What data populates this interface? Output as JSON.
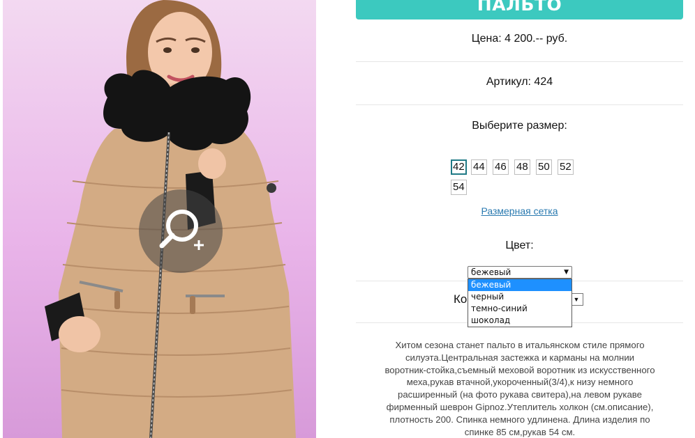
{
  "product": {
    "title": "ПАЛЬТО",
    "price_label": "Цена: ",
    "price_value": "4 200.-- руб.",
    "article_label": "Артикул: ",
    "article_value": "424",
    "size_label": "Выберите размер:",
    "sizes": [
      "42",
      "44",
      "46",
      "48",
      "50",
      "52",
      "54"
    ],
    "selected_size": "42",
    "size_chart_link": "Размерная сетка",
    "color_label": "Цвет:",
    "color_selected": "бежевый",
    "color_options": [
      "бежевый",
      "черный",
      "темно-синий",
      "шоколад"
    ],
    "quantity_label_visible": "Ко",
    "description": "Хитом сезона станет пальто в итальянском стиле прямого силуэта.Центральная застежка и карманы на молнии воротник-стойка,съемный меховой воротник из искусственного меха,рукав втачной,укороченный(3/4),к низу немного расширенный (на фото рукава свитера),на левом рукаве фирменный шеврон Gipnoz.Утеплитель холкон (см.описание), плотность 200. Спинка немного удлинена. Длина изделия по спинке 85 см,рукав 54 см."
  },
  "icons": {
    "zoom": "zoom-in-icon",
    "dropdown_arrow": "triangle-down-icon"
  },
  "colors": {
    "title_bar": "#3cc9bf",
    "link": "#2a7ab0",
    "dropdown_highlight": "#1e90ff",
    "active_size_border": "#1f7a86"
  }
}
